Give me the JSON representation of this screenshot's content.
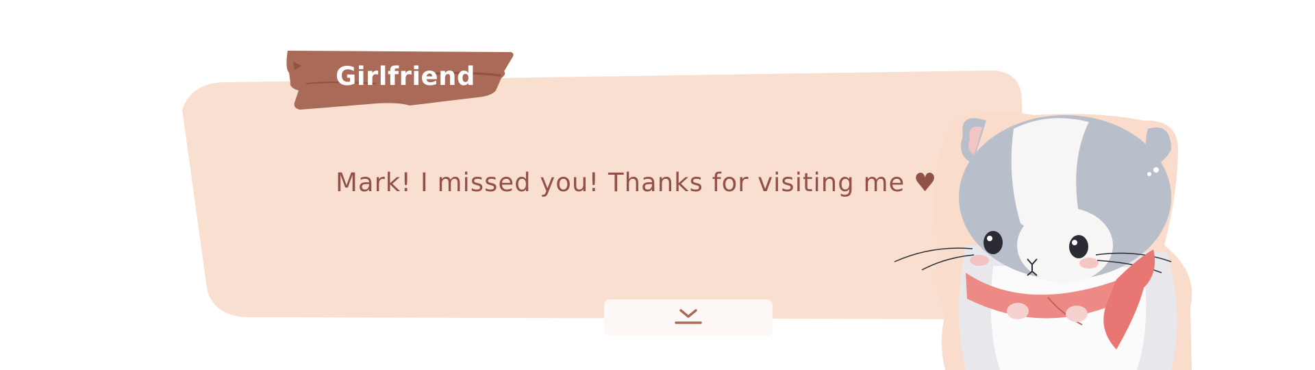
{
  "dialog": {
    "speaker": "Girlfriend",
    "text": "Mark! I missed you! Thanks for visiting me ♥"
  },
  "colors": {
    "panel": "#f8dfd0",
    "nameplate": "#a96a57",
    "text": "#915048",
    "button": "#fdf8f5",
    "icon": "#a96a57"
  },
  "icons": {
    "advance": "chevron-down-with-bar-icon"
  },
  "character": {
    "type": "hamster-with-red-scarf"
  }
}
